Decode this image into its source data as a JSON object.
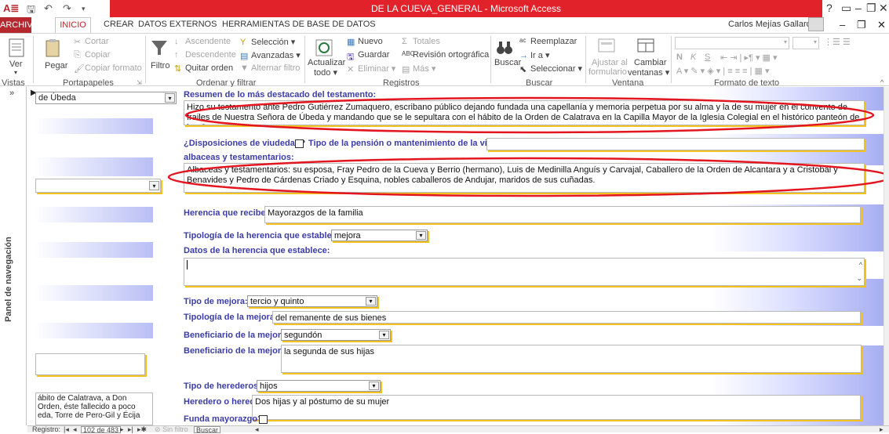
{
  "window": {
    "title": "DE LA CUEVA_GENERAL - Microsoft Access",
    "user": "Carlos Mejías Gallardo",
    "help": "?"
  },
  "tabs": [
    "ARCHIVO",
    "INICIO",
    "CREAR",
    "DATOS EXTERNOS",
    "HERRAMIENTAS DE BASE DE DATOS"
  ],
  "ribbon": {
    "vistas": {
      "ver": "Ver",
      "group": "Vistas"
    },
    "portapapeles": {
      "pegar": "Pegar",
      "cortar": "Cortar",
      "copiar": "Copiar",
      "copiar_formato": "Copiar formato",
      "group": "Portapapeles"
    },
    "ordenar": {
      "filtro": "Filtro",
      "ascendente": "Ascendente",
      "descendente": "Descendente",
      "quitar_orden": "Quitar orden",
      "seleccion": "Selección",
      "avanzadas": "Avanzadas",
      "alternar_filtro": "Alternar filtro",
      "group": "Ordenar y filtrar"
    },
    "registros": {
      "actualizar": "Actualizar",
      "todo": "todo",
      "nuevo": "Nuevo",
      "guardar": "Guardar",
      "eliminar": "Eliminar",
      "totales": "Totales",
      "revision": "Revisión ortográfica",
      "mas": "Más",
      "group": "Registros"
    },
    "buscar": {
      "buscar": "Buscar",
      "reemplazar": "Reemplazar",
      "ir_a": "Ir a",
      "seleccionar": "Seleccionar",
      "group": "Buscar"
    },
    "ventana": {
      "ajustar": "Ajustar al",
      "formulario": "formulario",
      "cambiar": "Cambiar",
      "ventanas": "ventanas",
      "group": "Ventana"
    },
    "formato": {
      "group": "Formato de texto",
      "bold": "N",
      "italic": "K",
      "underline": "S"
    }
  },
  "navpane": {
    "label": "Panel de navegación",
    "toggle": "»"
  },
  "left": {
    "combo1": "de Úbeda",
    "text_lines": [
      "ábito de Calatrava, a Don",
      "Orden, éste fallecido a poco",
      "eda, Torre de Pero-Gil y Écija"
    ]
  },
  "form": {
    "resumen_label": "Resumen de lo más destacado del testamento:",
    "resumen_text": "Hizo su testamento ante Pedro Gutiérrez Zumaquero, escribano público dejando fundada una capellanía y memoria perpetua por su alma y la de su mujer en el convento de frailes de Nuestra Señora de Úbeda y mandando que se le sepultara con el hábito de la Orden de Calatrava en la Capilla Mayor de la Iglesia Colegial en el histórico panteón de los Cueva.",
    "viudedad_label": "¿Disposiciones de viudedad?",
    "pension_label": "Tipo de la pensión o mantenimiento de la viuda:",
    "albaceas_label": "albaceas y testamentarios:",
    "albaceas_text": "Albaceas y testamentarios: su esposa, Fray Pedro de la Cueva y Berrio (hermano), Luis de Medinilla Anguís y Carvajal, Caballero de la Orden de Alcantara y a Cristobal y Benavides y Pedro de Cárdenas Criado y Esquina, nobles caballeros de Andujar, maridos de sus cuñadas.",
    "herencia_label": "Herencia que recibe:",
    "herencia_value": "Mayorazgos de la familia",
    "tipologia_herencia_label": "Tipología de la herencia que establece:",
    "tipologia_herencia_value": "mejora",
    "datos_herencia_label": "Datos de la herencia que establece:",
    "tipo_mejora_label": "Tipo de mejora:",
    "tipo_mejora_value": "tercio y quinto",
    "tipologia_mejora_label": "Tipología de la mejora:",
    "tipologia_mejora_value": "del remanente de sus bienes",
    "beneficiario_combo_label": "Beneficiario de la mejora*:",
    "beneficiario_combo_value": "segundón",
    "beneficiario_label": "Beneficiario de la mejora:",
    "beneficiario_value": "la segunda de sus hijas",
    "tipo_herederos_label": "Tipo de herederos:",
    "tipo_herederos_value": "hijos",
    "herederos_label": "Heredero o herederos:",
    "herederos_value": "Dos hijas y al póstumo de su mujer",
    "funda_label": "Funda mayorazgo?"
  },
  "statusbar": {
    "registro": "Registro:",
    "position": "102 de 483",
    "sin_filtro": "Sin filtro",
    "buscar": "Buscar"
  },
  "colors": {
    "accent": "#b7282e",
    "title_red": "#e1222b",
    "annotation": "#e3161f",
    "label_blue": "#3c3ca8",
    "yellow_shadow": "#f4c21c"
  }
}
